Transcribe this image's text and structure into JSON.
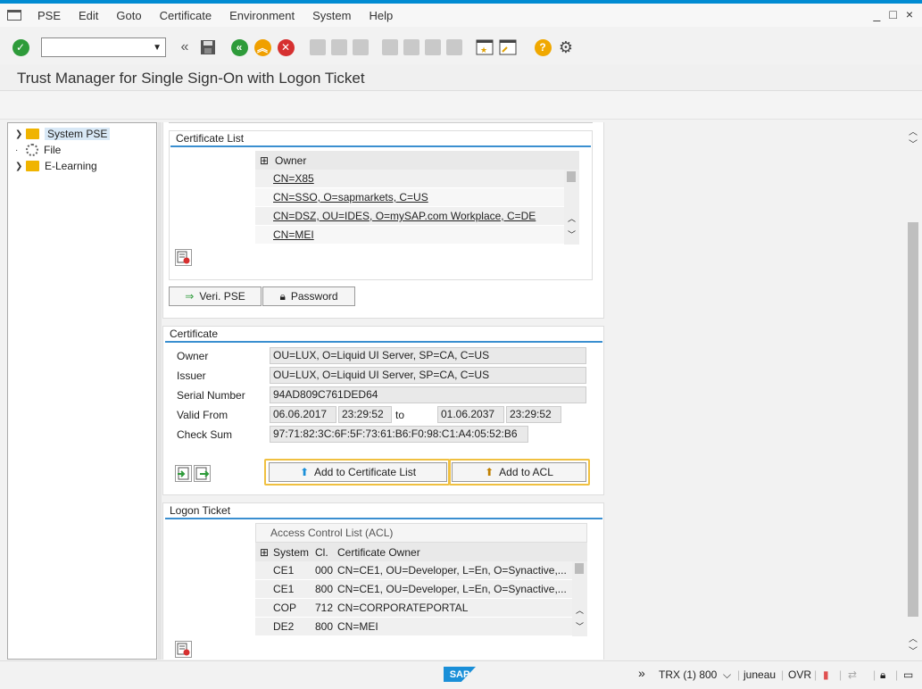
{
  "menubar": {
    "items": [
      "PSE",
      "Edit",
      "Goto",
      "Certificate",
      "Environment",
      "System",
      "Help"
    ],
    "window_controls": [
      "_",
      "□",
      "×"
    ]
  },
  "toolbar": {
    "command_field": ""
  },
  "title": "Trust Manager for Single Sign-On with Logon Ticket",
  "tree": {
    "items": [
      {
        "label": "System PSE",
        "icon": "folder-icon",
        "selected": true
      },
      {
        "label": "File",
        "icon": "gear-icon"
      },
      {
        "label": "E-Learning",
        "icon": "folder-icon"
      }
    ]
  },
  "cert_list": {
    "group_title": "Certificate List",
    "header": "Owner",
    "rows": [
      "CN=X85",
      "CN=SSO, O=sapmarkets, C=US",
      "CN=DSZ, OU=IDES, O=mySAP.com Workplace, C=DE",
      "CN=MEI"
    ],
    "buttons": {
      "veri_pse": "Veri. PSE",
      "password": "Password"
    }
  },
  "certificate": {
    "group_title": "Certificate",
    "owner_label": "Owner",
    "owner": "OU=LUX, O=Liquid UI Server, SP=CA, C=US",
    "issuer_label": "Issuer",
    "issuer": "OU=LUX, O=Liquid UI Server, SP=CA, C=US",
    "serial_label": "Serial Number",
    "serial": "94AD809C761DED64",
    "valid_from_label": "Valid From",
    "valid_from_date": "06.06.2017",
    "valid_from_time": "23:29:52",
    "to_label": "to",
    "valid_to_date": "01.06.2037",
    "valid_to_time": "23:29:52",
    "checksum_label": "Check Sum",
    "checksum": "97:71:82:3C:6F:5F:73:61:B6:F0:98:C1:A4:05:52:B6",
    "add_cert_button": "Add to Certificate List",
    "add_acl_button": "Add to ACL"
  },
  "logon_ticket": {
    "group_title": "Logon Ticket",
    "acl_title": "Access Control List (ACL)",
    "columns": [
      "System",
      "Cl.",
      "Certificate Owner"
    ],
    "rows": [
      {
        "system": "CE1",
        "client": "000",
        "owner": "CN=CE1, OU=Developer, L=En, O=Synactive,..."
      },
      {
        "system": "CE1",
        "client": "800",
        "owner": "CN=CE1, OU=Developer, L=En, O=Synactive,..."
      },
      {
        "system": "COP",
        "client": "712",
        "owner": "CN=CORPORATEPORTAL"
      },
      {
        "system": "DE2",
        "client": "800",
        "owner": "CN=MEI"
      }
    ]
  },
  "statusbar": {
    "logo": "SAP",
    "expand": "»",
    "trx": "TRX (1) 800",
    "dropdown": "⌵",
    "user": "juneau",
    "mode": "OVR"
  },
  "colors": {
    "accent": "#008bd2",
    "group_underline": "#3a8fd0",
    "folder": "#f0b400",
    "highlight_border": "#f0c040"
  }
}
